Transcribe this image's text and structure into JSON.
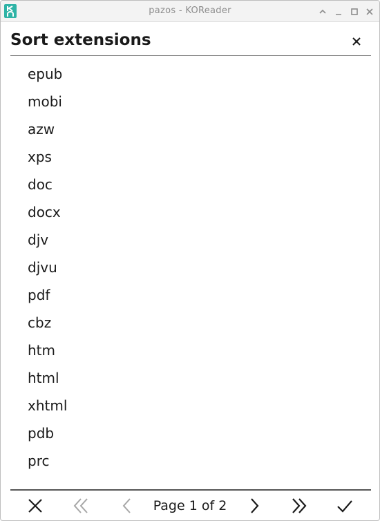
{
  "window": {
    "title": "pazos - KOReader"
  },
  "dialog": {
    "title": "Sort extensions"
  },
  "extensions": [
    "epub",
    "mobi",
    "azw",
    "xps",
    "doc",
    "docx",
    "djv",
    "djvu",
    "pdf",
    "cbz",
    "htm",
    "html",
    "xhtml",
    "pdb",
    "prc"
  ],
  "footer": {
    "page_label": "Page 1 of 2"
  },
  "icons": {
    "app": "koreader-logo-icon",
    "minimize": "minimize-icon",
    "maximize": "maximize-icon",
    "roll_up": "chevron-up-icon",
    "window_close": "close-icon",
    "dialog_close": "close-icon",
    "cancel": "cancel-icon",
    "first_page": "double-chevron-left-icon",
    "prev_page": "chevron-left-icon",
    "next_page": "chevron-right-icon",
    "last_page": "double-chevron-right-icon",
    "confirm": "checkmark-icon"
  },
  "colors": {
    "accent": "#2eb3a6",
    "text": "#1a1a1a",
    "disabled": "#a6a6a6"
  }
}
